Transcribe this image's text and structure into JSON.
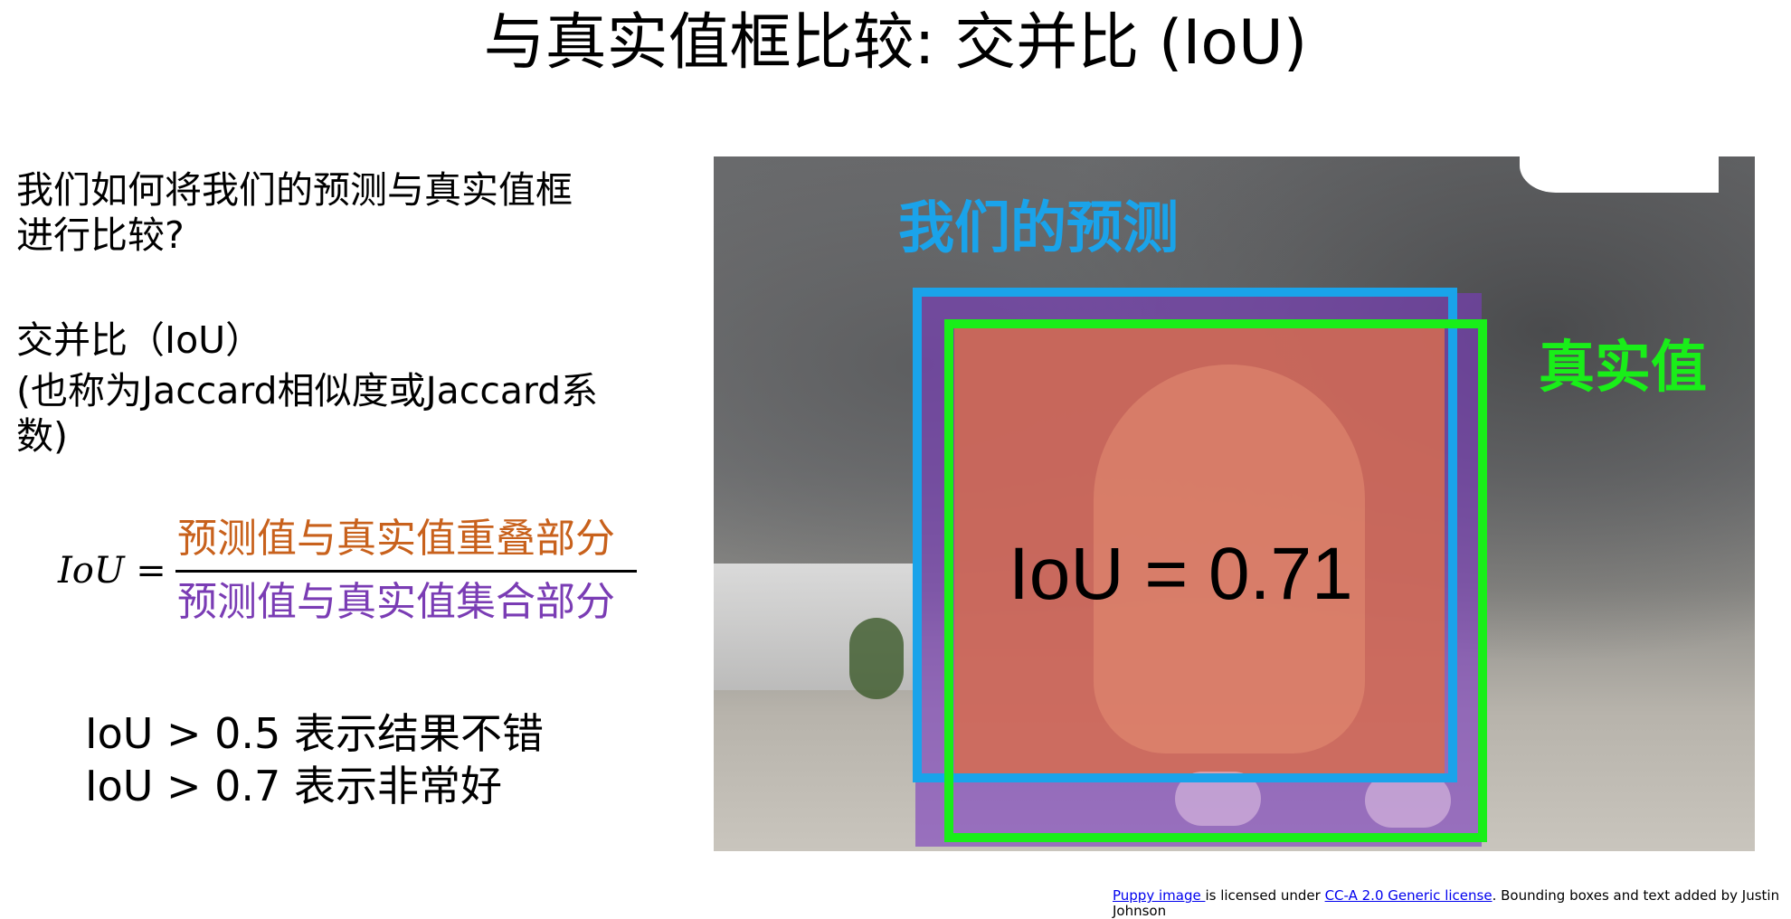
{
  "title": "与真实值框比较: 交并比 (IoU)",
  "left": {
    "question_line1": "我们如何将我们的预测与真实值框",
    "question_line2": "进行比较?",
    "iou_heading": "交并比（IoU）",
    "aka_line1": "(也称为Jaccard相似度或Jaccard系",
    "aka_line2": "数)"
  },
  "formula": {
    "lhs": "IoU =",
    "numerator": "预测值与真实值重叠部分",
    "denominator": "预测值与真实值集合部分",
    "numerator_color": "#c8611c",
    "denominator_color": "#7a3cb4"
  },
  "notes": [
    "IoU > 0.5 表示结果不错",
    "IoU > 0.7 表示非常好"
  ],
  "image": {
    "prediction_label": "我们的预测",
    "ground_truth_label": "真实值",
    "iou_value_text": "IoU = 0.71",
    "prediction_color": "#1aa3ea",
    "ground_truth_color": "#19ee19",
    "intersection_color": "#d66c50",
    "union_color": "#7a3cbe"
  },
  "credit": {
    "link1": "Puppy image ",
    "text1": "is licensed under ",
    "link2": "CC-A 2.0 Generic license",
    "text2": ". Bounding boxes and text added by Justin",
    "text3": "Johnson"
  }
}
